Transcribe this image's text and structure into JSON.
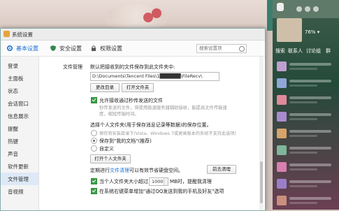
{
  "window": {
    "title": "系统设置"
  },
  "toolbar": {
    "tabs": [
      {
        "label": "基本设置",
        "icon": "gear-icon",
        "active": true
      },
      {
        "label": "安全设置",
        "icon": "shield-icon",
        "active": false
      },
      {
        "label": "权限设置",
        "icon": "lock-icon",
        "active": false
      }
    ],
    "search_placeholder": "搜索设置项"
  },
  "nav": {
    "items": [
      "登录",
      "主面板",
      "状态",
      "会话窗口",
      "信息展示",
      "提醒",
      "热键",
      "声音",
      "软件更新",
      "文件管理",
      "音视频"
    ],
    "active_index": 9
  },
  "file_mgmt": {
    "label": "文件管理",
    "save_desc": "默认把接收到的文件保存到此文件夹中:",
    "path": "D:\\Documents\\Tencent Files\\1██████\\FileRecv\\",
    "change_dir_btn": "更改目录",
    "open_folder_btn": "打开文件夹",
    "allow_transit": "允许接收通过秒传发送的文件",
    "transit_desc_1": "秒传发送的文件，将使用极速服务器辅助接收，能提高文件传输速",
    "transit_desc_2": "度，缩短传输时间。",
    "personal_folder_desc": "选择个人文件夹(用于保存消息记录等数据)的保存位置。",
    "opt_install_dir": "保存到安装目录下(Vista、Windows 7或更高版本的系统不支持此选项)",
    "opt_my_docs": "保存到\"我的文档\"(推荐)",
    "opt_custom": "自定义",
    "open_personal_btn": "打开个人文件夹",
    "cleanup_prefix": "定期进行",
    "cleanup_link": "文件清理",
    "cleanup_suffix": "可以有效节省硬盘空间。",
    "cleanup_btn": "前去清理",
    "size_prefix": "当个人文件夹大小超过",
    "size_value": "1000",
    "size_suffix": "MB时，提醒我清理",
    "context_menu": "在系统右键菜单增加\"通过QQ发送到我的手机及好友\"选项"
  },
  "sidebar": {
    "status_text": "76% ▾",
    "tabs": [
      "搜索",
      "联系人",
      "讨论组",
      "群"
    ]
  },
  "colors": {
    "accent": "#1c6fd6",
    "checkbox_green": "#3aa04a",
    "sidebar_top": "#3f5d4b",
    "sidebar_bottom": "#6b3f52"
  }
}
